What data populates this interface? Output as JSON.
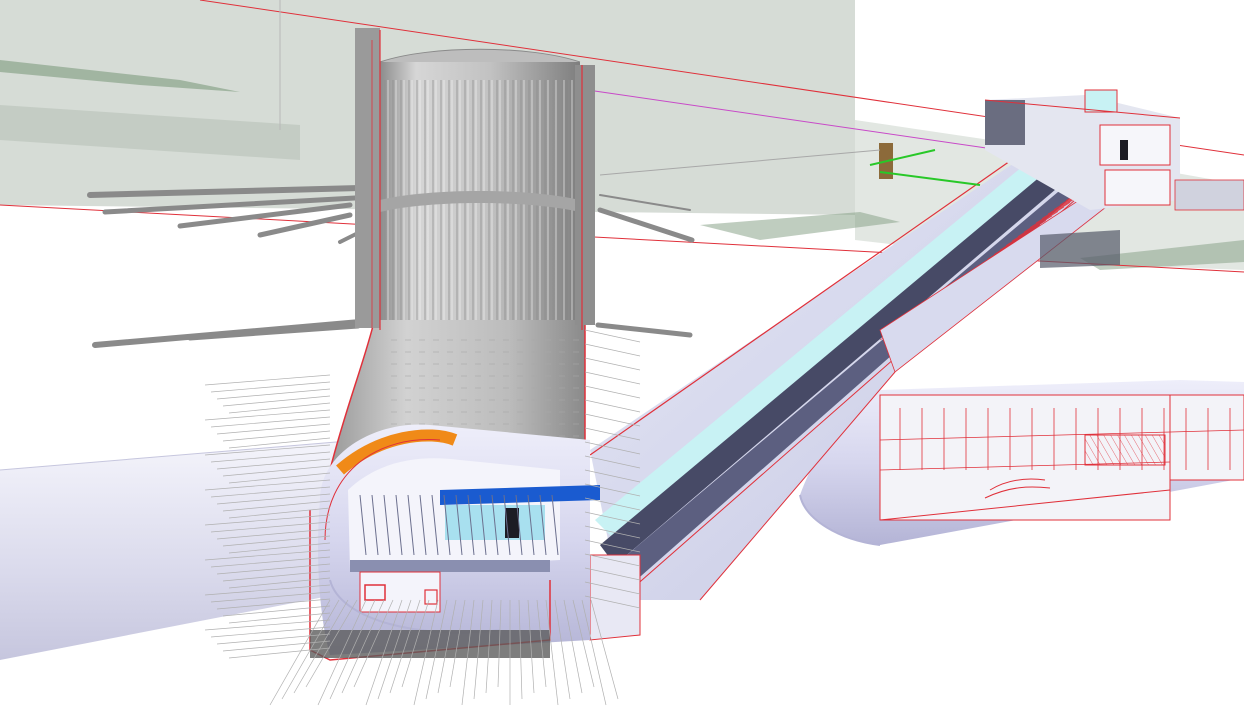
{
  "scene": {
    "colors": {
      "background": "#ffffff",
      "ground_plane": "#cfd6cf",
      "ground_plane_shade": "#bfc8bf",
      "terrain_green": "#8aa48a",
      "section_red": "#e0303a",
      "shaft_light": "#dadada",
      "shaft_mid": "#b4b4b4",
      "shaft_dark": "#7d7d7d",
      "tunnel_lavender": "#dcdcf2",
      "tunnel_shade": "#b8b8d8",
      "escalator_cyan": "#c8f2f4",
      "escalator_dark": "#474a66",
      "platform_orange": "#f08a18",
      "platform_blue": "#1a5bd0",
      "anchor_grey": "#8a8a8a",
      "green_pipe": "#28c828",
      "bronze_pipe": "#8c6a3a",
      "magenta_line": "#c84ac8"
    },
    "components": [
      "ground-plane",
      "ventilation-shaft",
      "shaft-upper-cylinder",
      "shaft-lower-cone",
      "rock-anchors",
      "platform-tunnel",
      "inclined-escalator",
      "concourse-tunnel",
      "surface-entrance-building"
    ]
  }
}
